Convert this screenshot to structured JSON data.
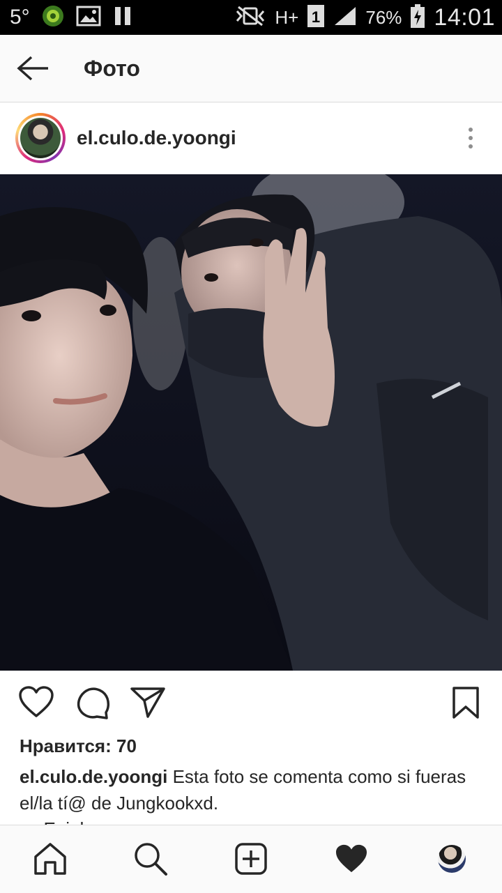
{
  "status_bar": {
    "temperature": "5°",
    "network": "H+",
    "sim": "1",
    "battery": "76%",
    "time": "14:01"
  },
  "header": {
    "title": "Фото"
  },
  "post": {
    "username": "el.culo.de.yoongi",
    "likes": "Нравится: 70",
    "caption_username": "el.culo.de.yoongi",
    "caption_text": "Esta foto se comenta como si fueras el/la tí@ de Jungkookxd.",
    "caption_continuation": "_Epiphany"
  },
  "icons": {
    "back": "arrow-left-icon",
    "more": "more-vertical-icon",
    "like": "heart-icon",
    "comment": "comment-icon",
    "share": "send-icon",
    "save": "bookmark-icon",
    "home": "home-icon",
    "search": "search-icon",
    "new_post": "add-post-icon",
    "activity": "heart-filled-icon",
    "profile": "profile-avatar"
  },
  "colors": {
    "text": "#262626",
    "secondary": "#8e8e8e",
    "divider": "#dbdbdb",
    "statusbar": "#000000"
  }
}
